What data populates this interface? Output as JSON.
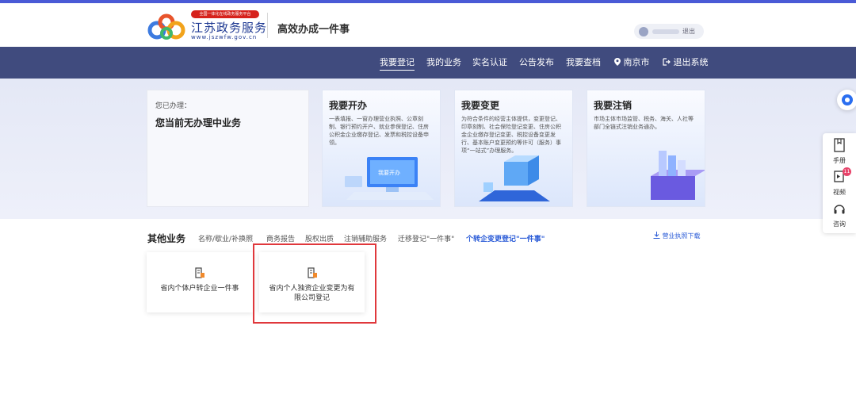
{
  "header": {
    "badge": "全国一体化在线政务服务平台",
    "site_name": "江苏政务服务",
    "site_url": "www.jszwfw.gov.cn",
    "subtitle": "高效办成一件事",
    "logout": "退出"
  },
  "nav": {
    "items": [
      {
        "label": "我要登记",
        "active": true
      },
      {
        "label": "我的业务"
      },
      {
        "label": "实名认证"
      },
      {
        "label": "公告发布"
      },
      {
        "label": "我要查档"
      }
    ],
    "city": "南京市",
    "exit": "退出系统"
  },
  "done": {
    "label": "您已办理：",
    "status": "您当前无办理中业务"
  },
  "services": [
    {
      "title": "我要开办",
      "desc": "一表填报、一窗办理营业执照、公章刻制、银行预约开户、就业参保登记、住房公积金企业缴存登记、发票和税控设备申领。",
      "illus_text": "我要开办"
    },
    {
      "title": "我要变更",
      "desc": "为符合条件的经营主体提供，变更登记、印章刻制、社会保险登记变更、住房公积金企业缴存登记变更、税控设备变更发行、基本账户变更预约等许可（服务）事项“一站式”办理服务。"
    },
    {
      "title": "我要注销",
      "desc": "市场主体市场监管、税务、海关、人社等部门全链式注销业务通办。"
    }
  ],
  "other": {
    "title": "其他业务",
    "tabs": [
      {
        "label": "名称/歇业/补换照"
      },
      {
        "label": "商务报告"
      },
      {
        "label": "股权出质"
      },
      {
        "label": "注销辅助服务"
      },
      {
        "label": "迁移登记\"一件事\""
      },
      {
        "label": "个转企变更登记\"一件事\"",
        "active": true
      }
    ],
    "download": "营业执照下载",
    "cards": [
      {
        "label": "省内个体户转企业一件事"
      },
      {
        "label": "省内个人独资企业变更为有限公司登记"
      }
    ]
  },
  "side": {
    "manual": "手册",
    "video": "视频",
    "video_badge": "11",
    "consult": "咨询"
  },
  "colors": {
    "nav_bg": "#404b7e",
    "accent": "#2a5bd7",
    "highlight": "#e0383c",
    "brand_red": "#d6221c"
  }
}
